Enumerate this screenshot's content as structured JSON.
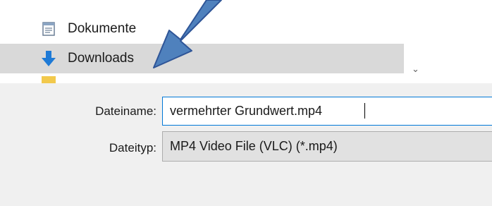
{
  "navigation": {
    "items": [
      {
        "label": "Dokumente",
        "icon": "document-icon"
      },
      {
        "label": "Downloads",
        "icon": "download-arrow-icon",
        "selected": true
      }
    ]
  },
  "save_form": {
    "filename_label": "Dateiname:",
    "filename_value": "vermehrter Grundwert.mp4",
    "filetype_label": "Dateityp:",
    "filetype_value": "MP4 Video File (VLC) (*.mp4)"
  },
  "colors": {
    "selection": "#d9d9d9",
    "panel": "#f0f0f0",
    "input_focus_border": "#0078d7",
    "annotation_arrow": "#4f81bd",
    "download_icon": "#1e7ad6"
  }
}
